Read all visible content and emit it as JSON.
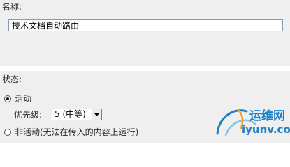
{
  "form": {
    "name_label": "名称:",
    "name_value": "技术文档自动路由",
    "status_label": "状态:",
    "active_label": "活动",
    "priority_label": "优先级:",
    "priority_selected": "5 (中等)",
    "inactive_label": "非活动(无法在传入的内容上运行)"
  },
  "watermark": {
    "title": "运维网",
    "domain": "iyunv.com"
  },
  "colors": {
    "section_bg": "#f0eff0",
    "input_border": "#7f9db9",
    "watermark_blue": "#1f7fc3"
  }
}
